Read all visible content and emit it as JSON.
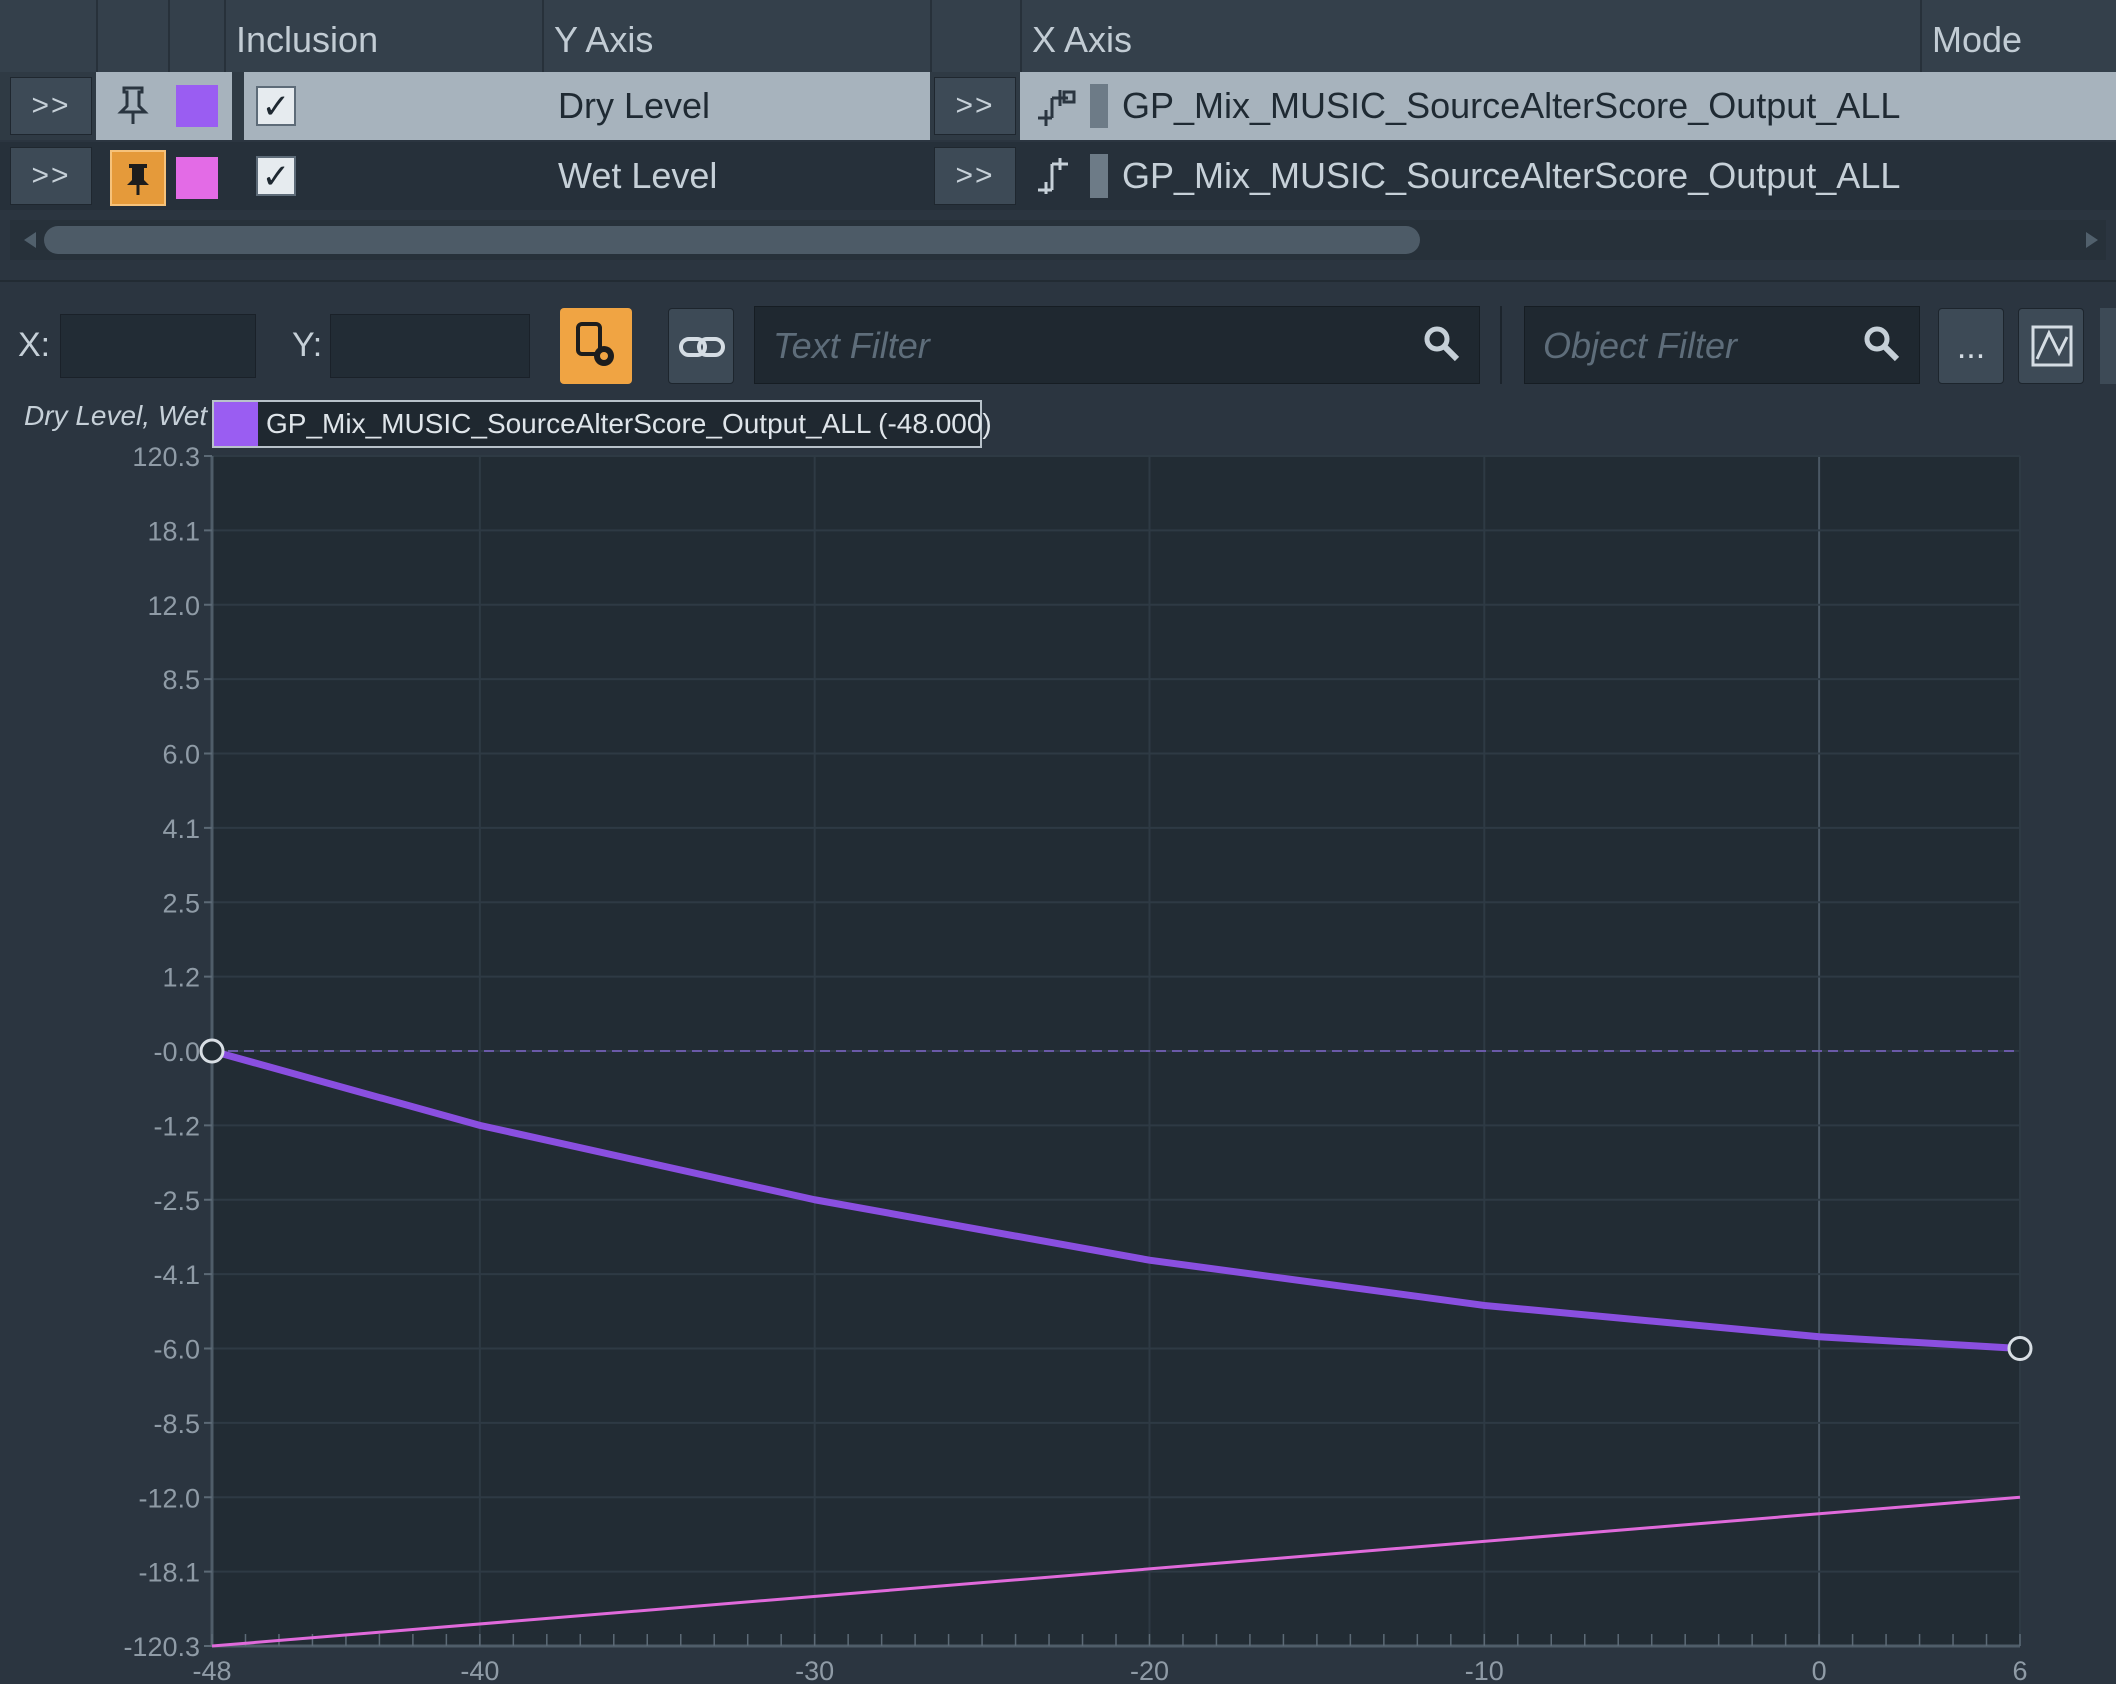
{
  "header": {
    "inclusion": "Inclusion",
    "y_axis": "Y Axis",
    "x_axis": "X Axis",
    "mode": "Mode"
  },
  "rows": [
    {
      "expand": ">>",
      "swatch_color": "#9a5df2",
      "checked": true,
      "y_axis": "Dry Level",
      "x_expand": ">>",
      "x_axis": "GP_Mix_MUSIC_SourceAlterScore_Output_ALL",
      "selected": true
    },
    {
      "expand": ">>",
      "swatch_color": "#e36be6",
      "checked": true,
      "y_axis": "Wet Level",
      "x_expand": ">>",
      "x_axis": "GP_Mix_MUSIC_SourceAlterScore_Output_ALL",
      "selected": false
    }
  ],
  "toolbar": {
    "x_label": "X:",
    "y_label": "Y:",
    "text_filter_placeholder": "Text Filter",
    "object_filter_placeholder": "Object Filter",
    "more_label": "..."
  },
  "graph": {
    "y_title": "Dry Level, Wet",
    "legend_color": "#9a5df2",
    "legend_label": "GP_Mix_MUSIC_SourceAlterScore_Output_ALL (-48.000)"
  },
  "chart_data": {
    "type": "line",
    "y_ticks": [
      "120.3",
      "18.1",
      "12.0",
      "8.5",
      "6.0",
      "4.1",
      "2.5",
      "1.2",
      "-0.0",
      "-1.2",
      "-2.5",
      "-4.1",
      "-6.0",
      "-8.5",
      "-12.0",
      "-18.1",
      "-120.3"
    ],
    "x_ticks": [
      "-48",
      "-40",
      "-30",
      "-20",
      "-10",
      "0",
      "6"
    ],
    "xlim": [
      -48,
      6
    ],
    "series": [
      {
        "color": "#8a4fe0",
        "x": [
          -48,
          -40,
          -30,
          -20,
          -10,
          0,
          6
        ],
        "y": [
          0,
          -1.2,
          -2.5,
          -3.8,
          -4.9,
          -5.7,
          -6.0
        ]
      },
      {
        "color": "#e06adb",
        "x": [
          -48,
          6
        ],
        "y": [
          -120.3,
          -12.0
        ]
      }
    ],
    "grid": true
  }
}
